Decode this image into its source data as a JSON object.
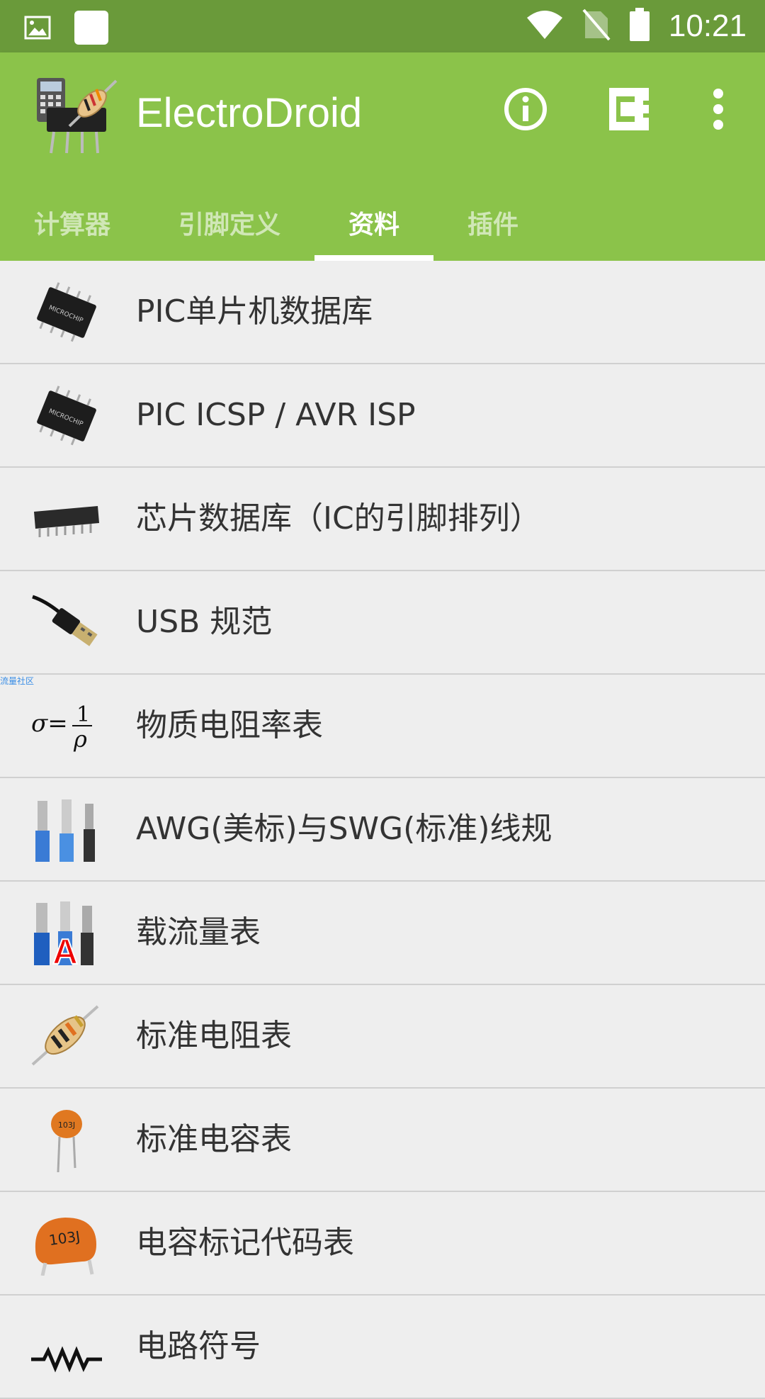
{
  "status_bar": {
    "time": "10:21",
    "icons": [
      "image-notification-icon",
      "square-notification-icon",
      "wifi-icon",
      "no-sim-icon",
      "battery-icon"
    ]
  },
  "app_bar": {
    "title": "ElectroDroid",
    "actions": [
      "info-icon",
      "plugin-icon",
      "overflow-menu-icon"
    ],
    "color": "#8bc34a"
  },
  "tabs": [
    {
      "label": "计算器",
      "active": false
    },
    {
      "label": "引脚定义",
      "active": false
    },
    {
      "label": "资料",
      "active": true
    },
    {
      "label": "插件",
      "active": false
    }
  ],
  "items": [
    {
      "label": "PIC单片机数据库",
      "icon": "pic-chip-icon"
    },
    {
      "label": "PIC ICSP / AVR ISP",
      "icon": "pic-chip-icon"
    },
    {
      "label": "芯片数据库（IC的引脚排列）",
      "icon": "dip-ic-icon"
    },
    {
      "label": "USB 规范",
      "icon": "usb-plug-icon"
    },
    {
      "label": "物质电阻率表",
      "icon": "resistivity-formula-icon"
    },
    {
      "label": "AWG(美标)与SWG(标准)线规",
      "icon": "wires-icon"
    },
    {
      "label": "载流量表",
      "icon": "wire-ampacity-icon"
    },
    {
      "label": "标准电阻表",
      "icon": "resistor-icon"
    },
    {
      "label": "标准电容表",
      "icon": "ceramic-capacitor-icon"
    },
    {
      "label": "电容标记代码表",
      "icon": "capacitor-code-icon"
    },
    {
      "label": "电路符号",
      "icon": "circuit-symbol-icon"
    }
  ],
  "watermark": "流量社区",
  "icon_text": {
    "chip_brand": "MICROCHIP",
    "cap_code": "103J",
    "ampacity": "A",
    "formula_lhs": "σ=",
    "formula_num": "1",
    "formula_den": "ρ"
  }
}
